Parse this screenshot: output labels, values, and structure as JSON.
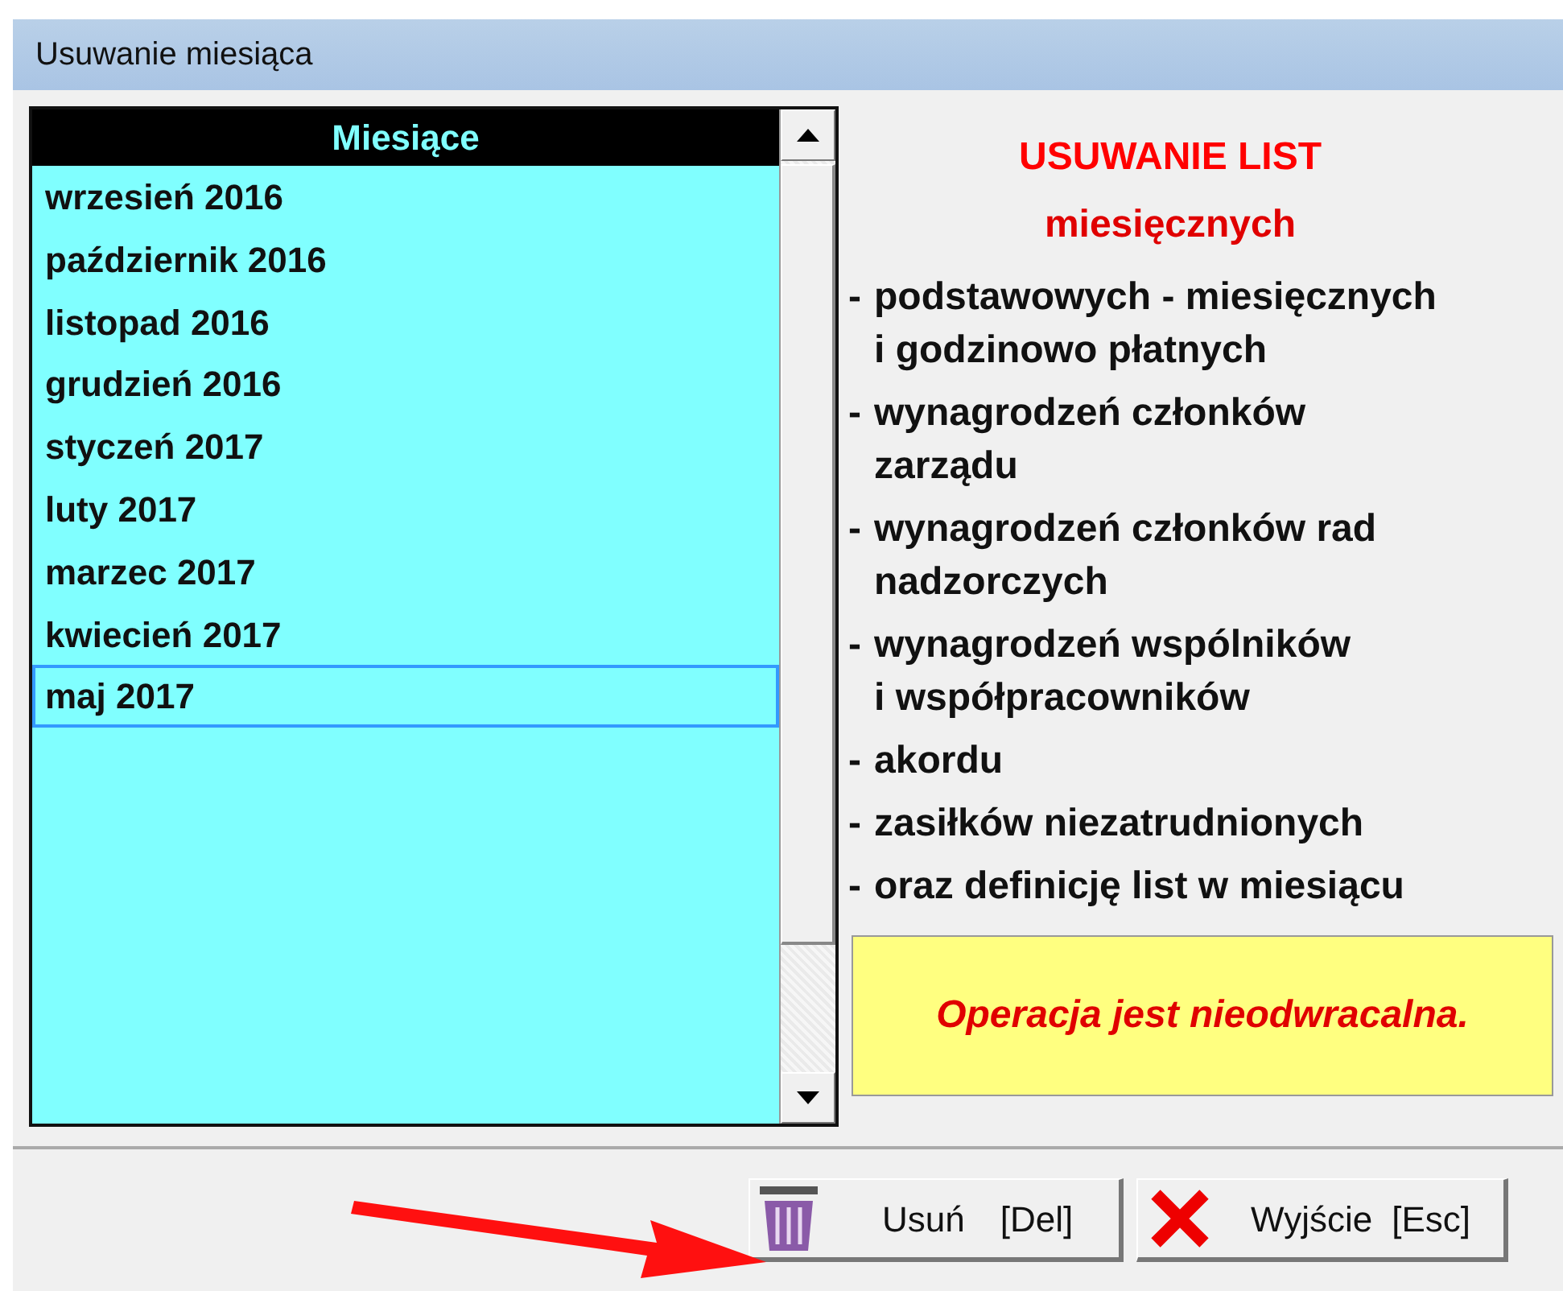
{
  "window": {
    "title": "Usuwanie miesiąca"
  },
  "months_list": {
    "header": "Miesiące",
    "items": [
      {
        "label": "wrzesień 2016",
        "selected": false
      },
      {
        "label": "październik 2016",
        "selected": false
      },
      {
        "label": "listopad 2016",
        "selected": false
      },
      {
        "label": "grudzień 2016",
        "selected": false
      },
      {
        "label": "styczeń 2017",
        "selected": false
      },
      {
        "label": "luty 2017",
        "selected": false
      },
      {
        "label": "marzec 2017",
        "selected": false
      },
      {
        "label": "kwiecień 2017",
        "selected": false
      },
      {
        "label": "maj 2017",
        "selected": true
      }
    ]
  },
  "info": {
    "title": "USUWANIE LIST",
    "subtitle": "miesięcznych",
    "items": [
      {
        "dash": "-",
        "lines": [
          "podstawowych - miesięcznych",
          "i godzinowo płatnych"
        ]
      },
      {
        "dash": "-",
        "lines": [
          "wynagrodzeń członków",
          "zarządu"
        ]
      },
      {
        "dash": "-",
        "lines": [
          "wynagrodzeń członków rad",
          "nadzorczych"
        ]
      },
      {
        "dash": "-",
        "lines": [
          "wynagrodzeń wspólników",
          "i współpracowników"
        ]
      },
      {
        "dash": "-",
        "lines": [
          "akordu"
        ]
      },
      {
        "dash": "-",
        "lines": [
          "zasiłków niezatrudnionych"
        ]
      },
      {
        "dash": "-",
        "lines": [
          "oraz definicję list w miesiącu"
        ]
      }
    ],
    "warning": "Operacja jest nieodwracalna."
  },
  "buttons": [
    {
      "kind": "delete",
      "label": "Usuń",
      "shortcut": "[Del]"
    },
    {
      "kind": "exit",
      "label": "Wyjście",
      "shortcut": "[Esc]"
    }
  ]
}
